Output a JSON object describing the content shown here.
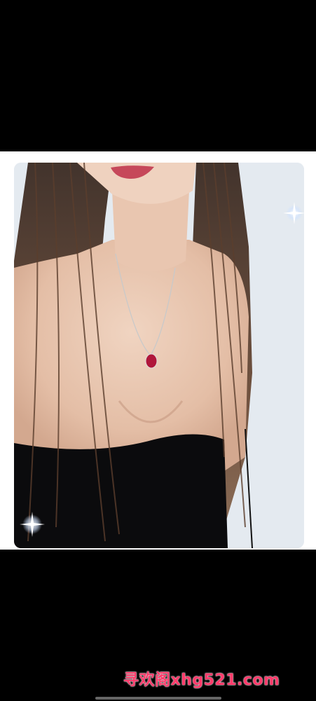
{
  "watermark": {
    "text": "寻欢阁xhg521.com",
    "color": "#ff3b6b"
  },
  "photo": {
    "background_color": "#e3e9ef",
    "dress_color": "#0b0b0d",
    "pendant_color": "#b0163a"
  }
}
